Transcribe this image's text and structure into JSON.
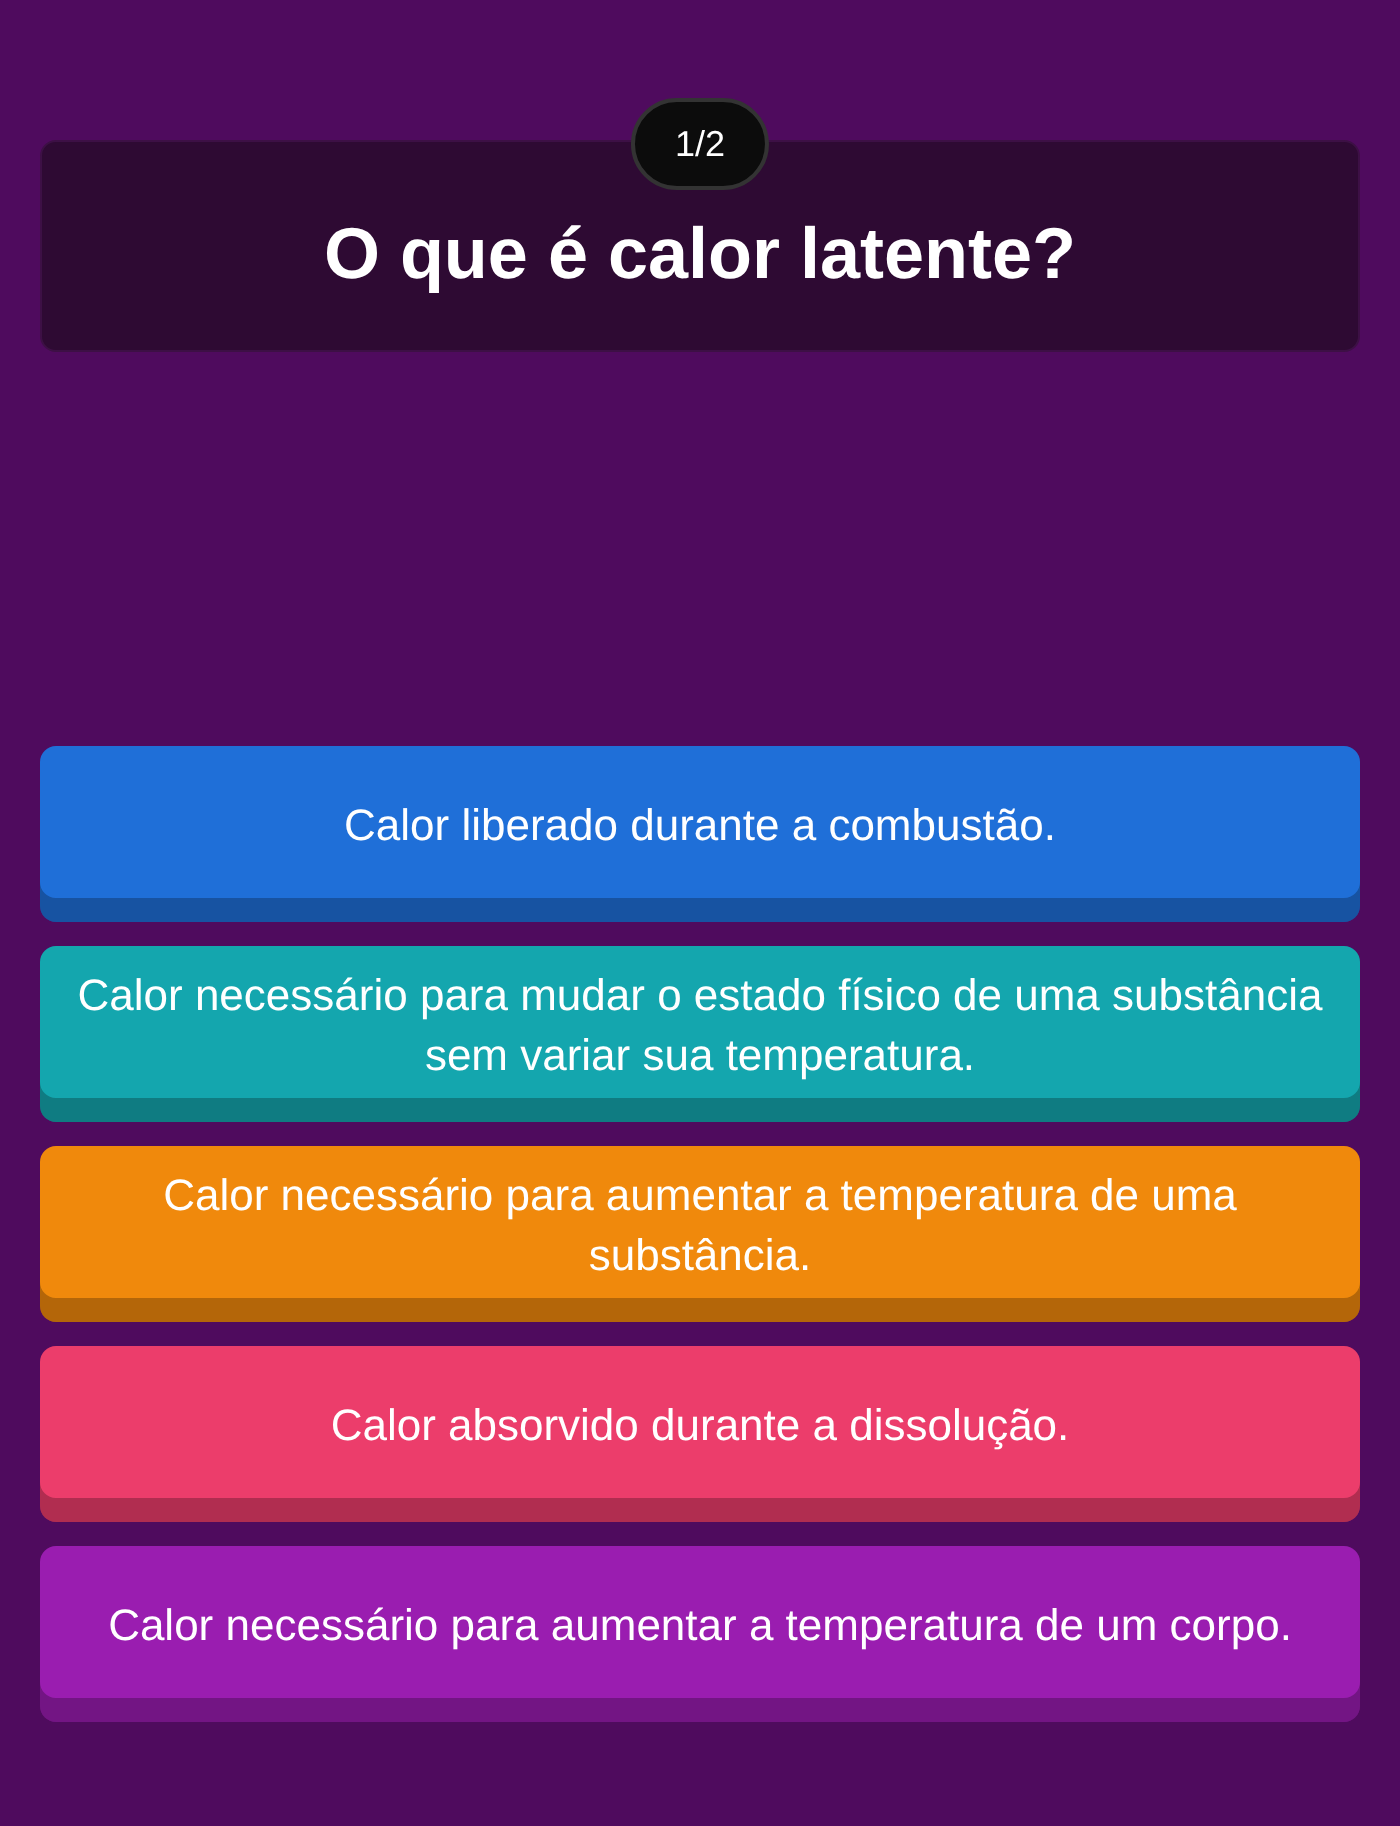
{
  "counter": "1/2",
  "question": "O que é calor latente?",
  "options": [
    {
      "text": "Calor liberado durante a combustão.",
      "color": "#1f6fd8"
    },
    {
      "text": "Calor necessário para mudar o estado físico de uma substância sem variar sua temperatura.",
      "color": "#14a6ae"
    },
    {
      "text": "Calor necessário para aumentar a temperatura de uma substância.",
      "color": "#f0890c"
    },
    {
      "text": "Calor absorvido durante a dissolução.",
      "color": "#ec3d6b"
    },
    {
      "text": "Calor necessário para aumentar a temperatura de um corpo.",
      "color": "#9a1db0"
    }
  ]
}
